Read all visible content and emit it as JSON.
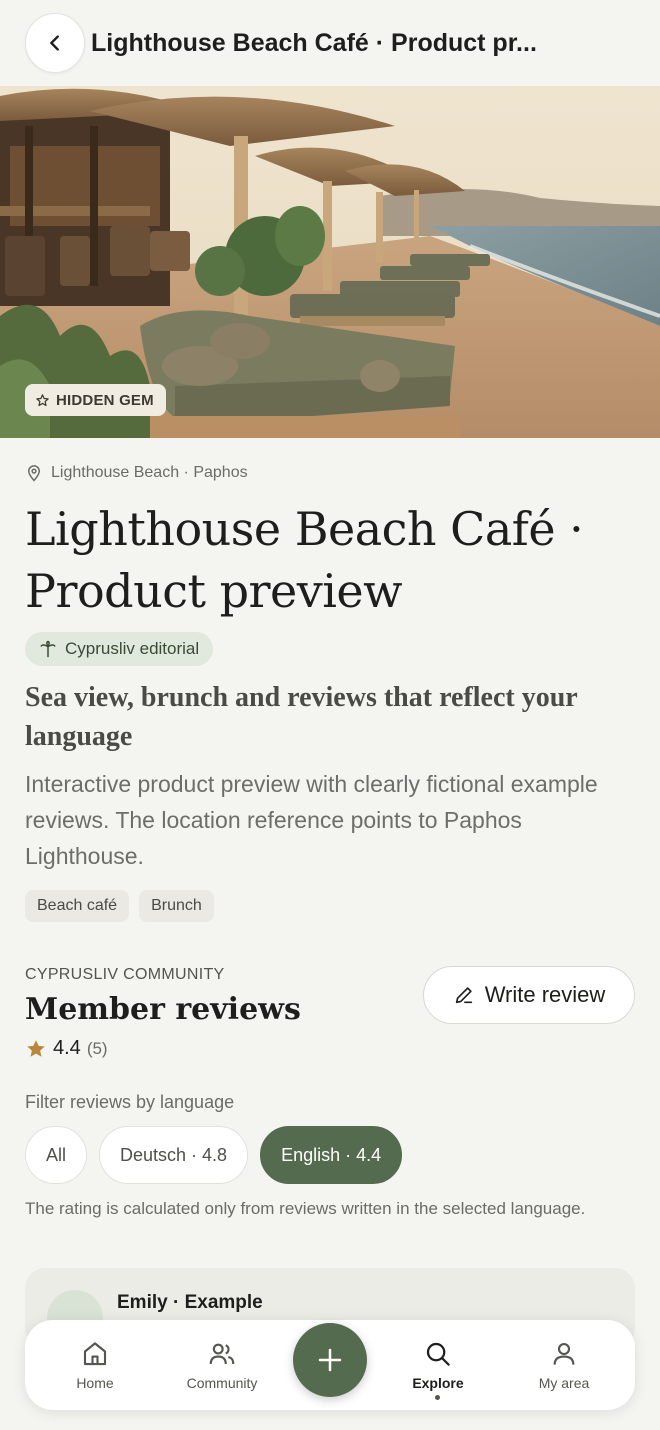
{
  "header": {
    "title": "Lighthouse Beach Café · Product pr..."
  },
  "hero": {
    "badge": "HIDDEN GEM"
  },
  "venue": {
    "location": "Lighthouse Beach · Paphos",
    "title": "Lighthouse Beach Café · Product preview",
    "editorial_badge": "Cyprusliv editorial",
    "subtitle": "Sea view, brunch and reviews that reflect your language",
    "description": "Interactive product preview with clearly fictional example reviews. The location reference points to Paphos Lighthouse.",
    "tags": [
      "Beach café",
      "Brunch"
    ]
  },
  "reviews": {
    "section_label": "CYPRUSLIV COMMUNITY",
    "title": "Member reviews",
    "rating_value": "4.4",
    "rating_count": "(5)",
    "write_review_label": "Write review",
    "filter_label": "Filter reviews by language",
    "filters": [
      {
        "label": "All",
        "active": false
      },
      {
        "label": "Deutsch · 4.8",
        "active": false
      },
      {
        "label": "English · 4.4",
        "active": true
      }
    ],
    "note": "The rating is calculated only from reviews written in the selected language.",
    "first_review_name": "Emily · Example"
  },
  "bottom_nav": {
    "items": [
      {
        "label": "Home",
        "icon": "home-icon"
      },
      {
        "label": "Community",
        "icon": "community-icon"
      },
      {
        "label": "Explore",
        "icon": "search-icon",
        "active": true
      },
      {
        "label": "My area",
        "icon": "user-icon"
      }
    ],
    "fab_icon": "plus-icon"
  },
  "colors": {
    "accent": "#546b4f",
    "background": "#f4f4f1",
    "star": "#b8873c"
  }
}
